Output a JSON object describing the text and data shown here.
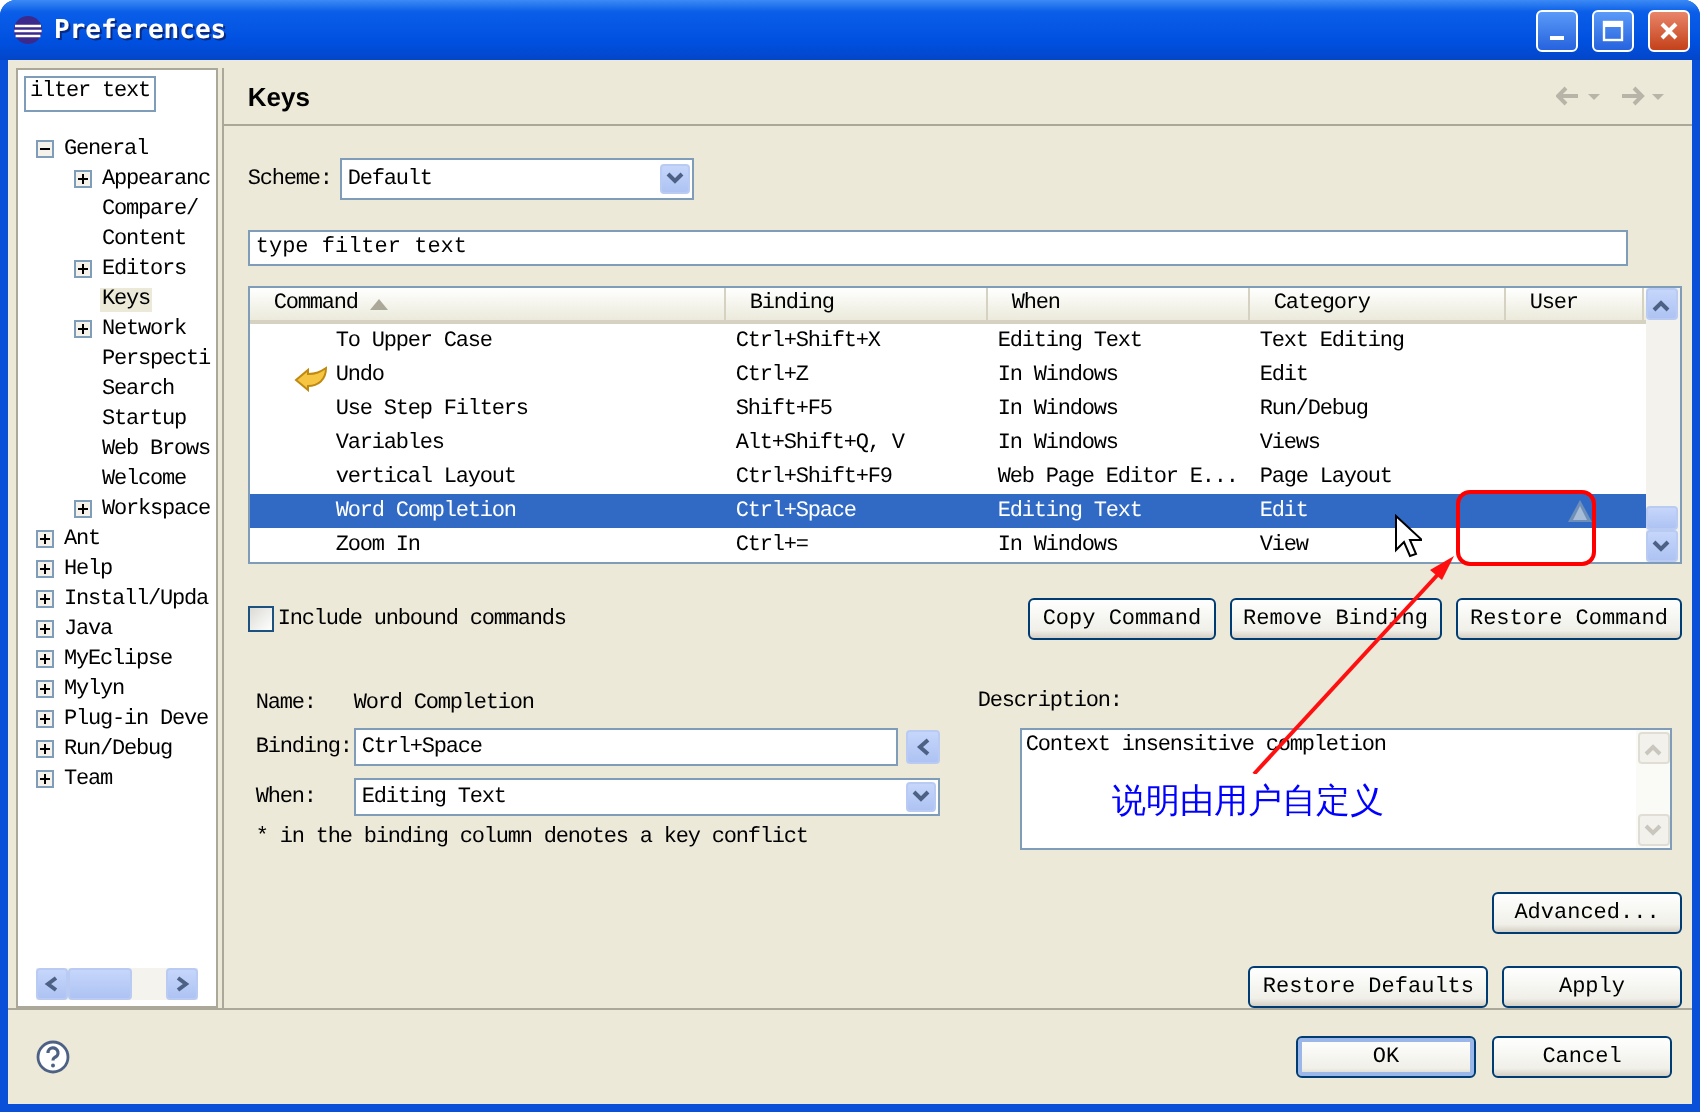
{
  "window": {
    "title": "Preferences"
  },
  "sidebar": {
    "filter": {
      "value": "ilter text"
    },
    "tree": [
      {
        "label": "General",
        "expanded": true,
        "children": [
          {
            "label": "Appearanc",
            "expanded": false,
            "selected": false
          },
          {
            "label": "Compare/",
            "selected": false
          },
          {
            "label": "Content",
            "selected": false
          },
          {
            "label": "Editors",
            "expanded": false,
            "selected": false
          },
          {
            "label": "Keys",
            "selected": true
          },
          {
            "label": "Network",
            "expanded": false,
            "selected": false
          },
          {
            "label": "Perspecti",
            "selected": false
          },
          {
            "label": "Search",
            "selected": false
          },
          {
            "label": "Startup",
            "selected": false
          },
          {
            "label": "Web Brows",
            "selected": false
          },
          {
            "label": "Welcome",
            "selected": false
          },
          {
            "label": "Workspace",
            "expanded": false,
            "selected": false
          }
        ],
        "selected": false
      },
      {
        "label": "Ant",
        "expanded": false,
        "selected": false
      },
      {
        "label": "Help",
        "expanded": false,
        "selected": false
      },
      {
        "label": "Install/Upda",
        "expanded": false,
        "selected": false
      },
      {
        "label": "Java",
        "expanded": false,
        "selected": false
      },
      {
        "label": "MyEclipse",
        "expanded": false,
        "selected": false
      },
      {
        "label": "Mylyn",
        "expanded": false,
        "selected": false
      },
      {
        "label": "Plug-in Deve",
        "expanded": false,
        "selected": false
      },
      {
        "label": "Run/Debug",
        "expanded": false,
        "selected": false
      },
      {
        "label": "Team",
        "expanded": false,
        "selected": false
      }
    ]
  },
  "page": {
    "title": "Keys",
    "scheme": {
      "label": "Scheme:",
      "value": "Default"
    },
    "filter": {
      "placeholder": "type filter text"
    },
    "table": {
      "columns": [
        {
          "label": "Command",
          "sorted": true
        },
        {
          "label": "Binding",
          "sorted": false
        },
        {
          "label": "When",
          "sorted": false
        },
        {
          "label": "Category",
          "sorted": false
        },
        {
          "label": "User",
          "sorted": false
        }
      ],
      "rows": [
        {
          "command": "To Upper Case",
          "binding": "Ctrl+Shift+X",
          "when": "Editing Text",
          "category": "Text Editing",
          "has_icon": false,
          "user_defined": false,
          "selected": false
        },
        {
          "command": "Undo",
          "binding": "Ctrl+Z",
          "when": "In Windows",
          "category": "Edit",
          "has_icon": true,
          "user_defined": false,
          "selected": false
        },
        {
          "command": "Use Step Filters",
          "binding": "Shift+F5",
          "when": "In Windows",
          "category": "Run/Debug",
          "has_icon": false,
          "user_defined": false,
          "selected": false
        },
        {
          "command": "Variables",
          "binding": "Alt+Shift+Q, V",
          "when": "In Windows",
          "category": "Views",
          "has_icon": false,
          "user_defined": false,
          "selected": false
        },
        {
          "command": "vertical Layout",
          "binding": "Ctrl+Shift+F9",
          "when": "Web Page Editor E...",
          "category": "Page Layout",
          "has_icon": false,
          "user_defined": false,
          "selected": false
        },
        {
          "command": "Word Completion",
          "binding": "Ctrl+Space",
          "when": "Editing Text",
          "category": "Edit",
          "has_icon": false,
          "user_defined": true,
          "selected": true
        },
        {
          "command": "Zoom In",
          "binding": "Ctrl+=",
          "when": "In Windows",
          "category": "View",
          "has_icon": false,
          "user_defined": false,
          "selected": false
        }
      ]
    },
    "include_unbound": {
      "label": "Include unbound commands",
      "checked": false
    },
    "command_buttons": [
      "Copy Command",
      "Remove Binding",
      "Restore Command"
    ],
    "details": {
      "name_label": "Name:",
      "name": "Word Completion",
      "binding_label": "Binding:",
      "binding": "Ctrl+Space",
      "when_label": "When:",
      "when": "Editing Text",
      "note": "* in the binding column denotes a key conflict",
      "description_label": "Description:",
      "description": "Context insensitive completion"
    },
    "advanced_button": "Advanced...",
    "page_buttons": [
      "Restore Defaults",
      "Apply"
    ]
  },
  "annotation": {
    "text": "说明由用户自定义"
  },
  "dialog_buttons": [
    "OK",
    "Cancel"
  ]
}
